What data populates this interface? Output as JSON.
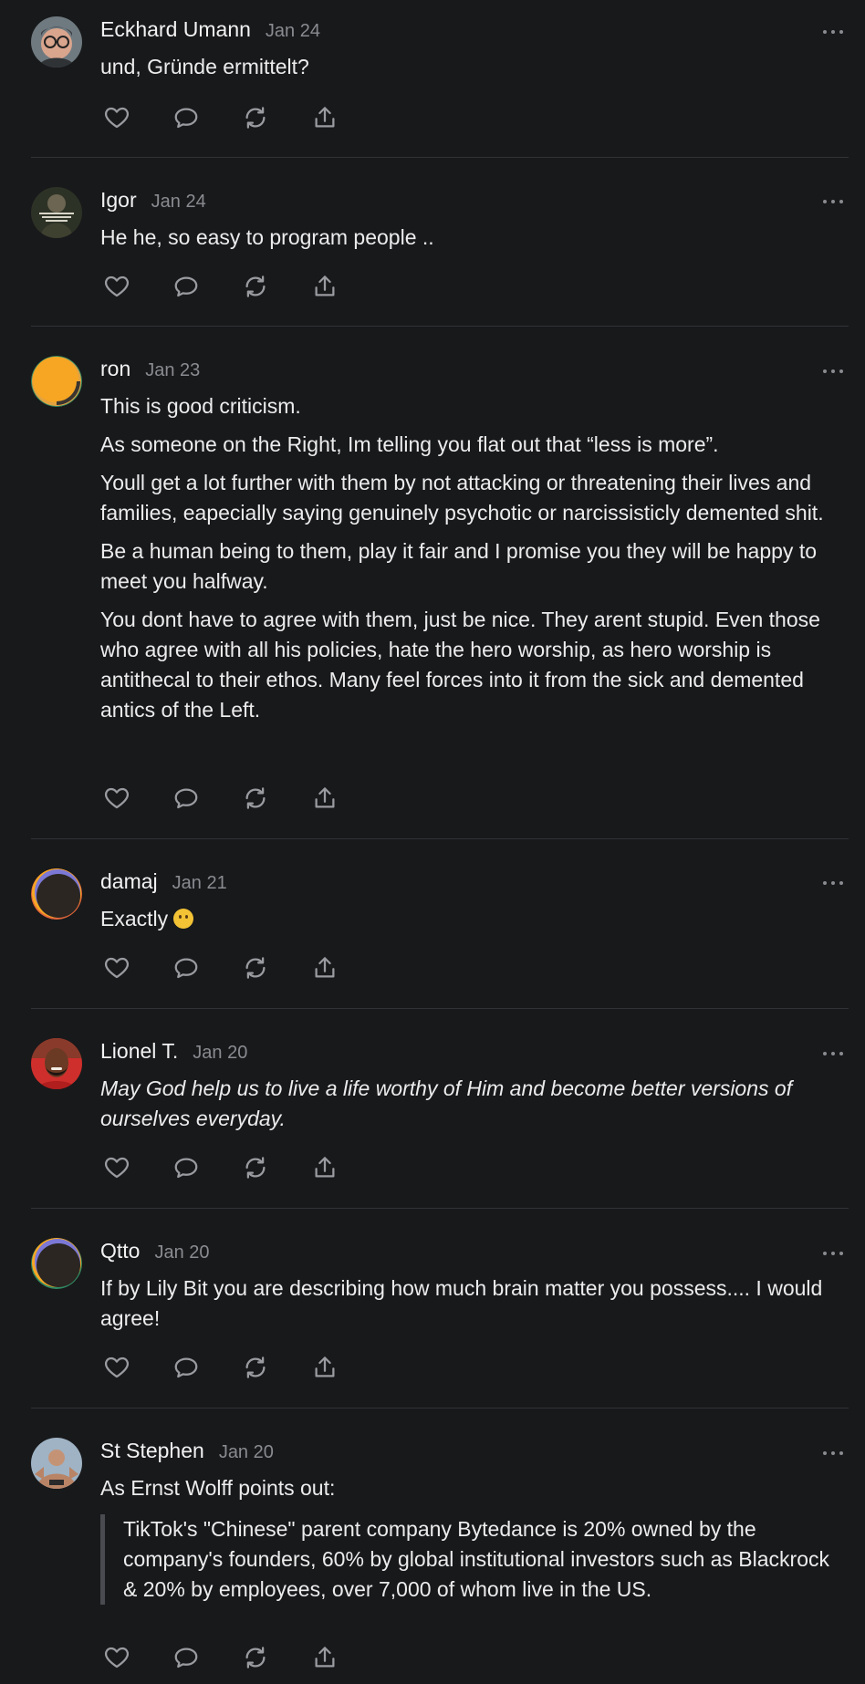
{
  "comments": [
    {
      "name": "Eckhard Umann",
      "date": "Jan 24",
      "paragraphs": [
        "und, Gründe ermittelt?"
      ],
      "avatar": "person-glasses-avatar"
    },
    {
      "name": "Igor",
      "date": "Jan 24",
      "paragraphs": [
        "He he, so easy to program people .."
      ],
      "avatar": "portrait-quote-avatar"
    },
    {
      "name": "ron",
      "date": "Jan 23",
      "paragraphs": [
        "This is good criticism.",
        "As someone on the Right, Im telling you flat out that “less is more”.",
        "Youll get a lot further with them by not attacking or threatening their lives and families, eapecially saying genuinely psychotic or narcissisticly demented shit.",
        "Be a human being to them, play it fair and I promise you they will be happy to meet you halfway.",
        "You dont have to agree with them, just be nice. They arent stupid. Even those who agree with all his policies, hate the hero worship, as hero worship is antithecal to their ethos. Many feel forces into it from the sick and demented antics of the Left."
      ],
      "avatar": "default-orange-avatar"
    },
    {
      "name": "damaj",
      "date": "Jan 21",
      "paragraphs": [
        "Exactly"
      ],
      "emoji": "thinking-face",
      "avatar": "default-dark-avatar"
    },
    {
      "name": "Lionel T.",
      "date": "Jan 20",
      "paragraphs": [
        "May God help us to live a life worthy of Him and become better versions of ourselves everyday."
      ],
      "italic": true,
      "avatar": "person-red-avatar"
    },
    {
      "name": "Qtto",
      "date": "Jan 20",
      "paragraphs": [
        "If by Lily Bit you are describing how much brain matter you possess.... I would agree!"
      ],
      "avatar": "default-dark-avatar"
    },
    {
      "name": "St Stephen",
      "date": "Jan 20",
      "paragraphs": [
        "As Ernst Wolff points out:"
      ],
      "quote": "TikTok's \"Chinese\" parent company Bytedance is 20% owned by the company's founders, 60% by global institutional investors such as Blackrock & 20% by employees, over 7,000 of whom live in the US.",
      "avatar": "person-statue-avatar"
    }
  ],
  "colors": {
    "background": "#18191b",
    "text": "#ececed",
    "muted": "#8a8b90",
    "divider": "#313236"
  }
}
